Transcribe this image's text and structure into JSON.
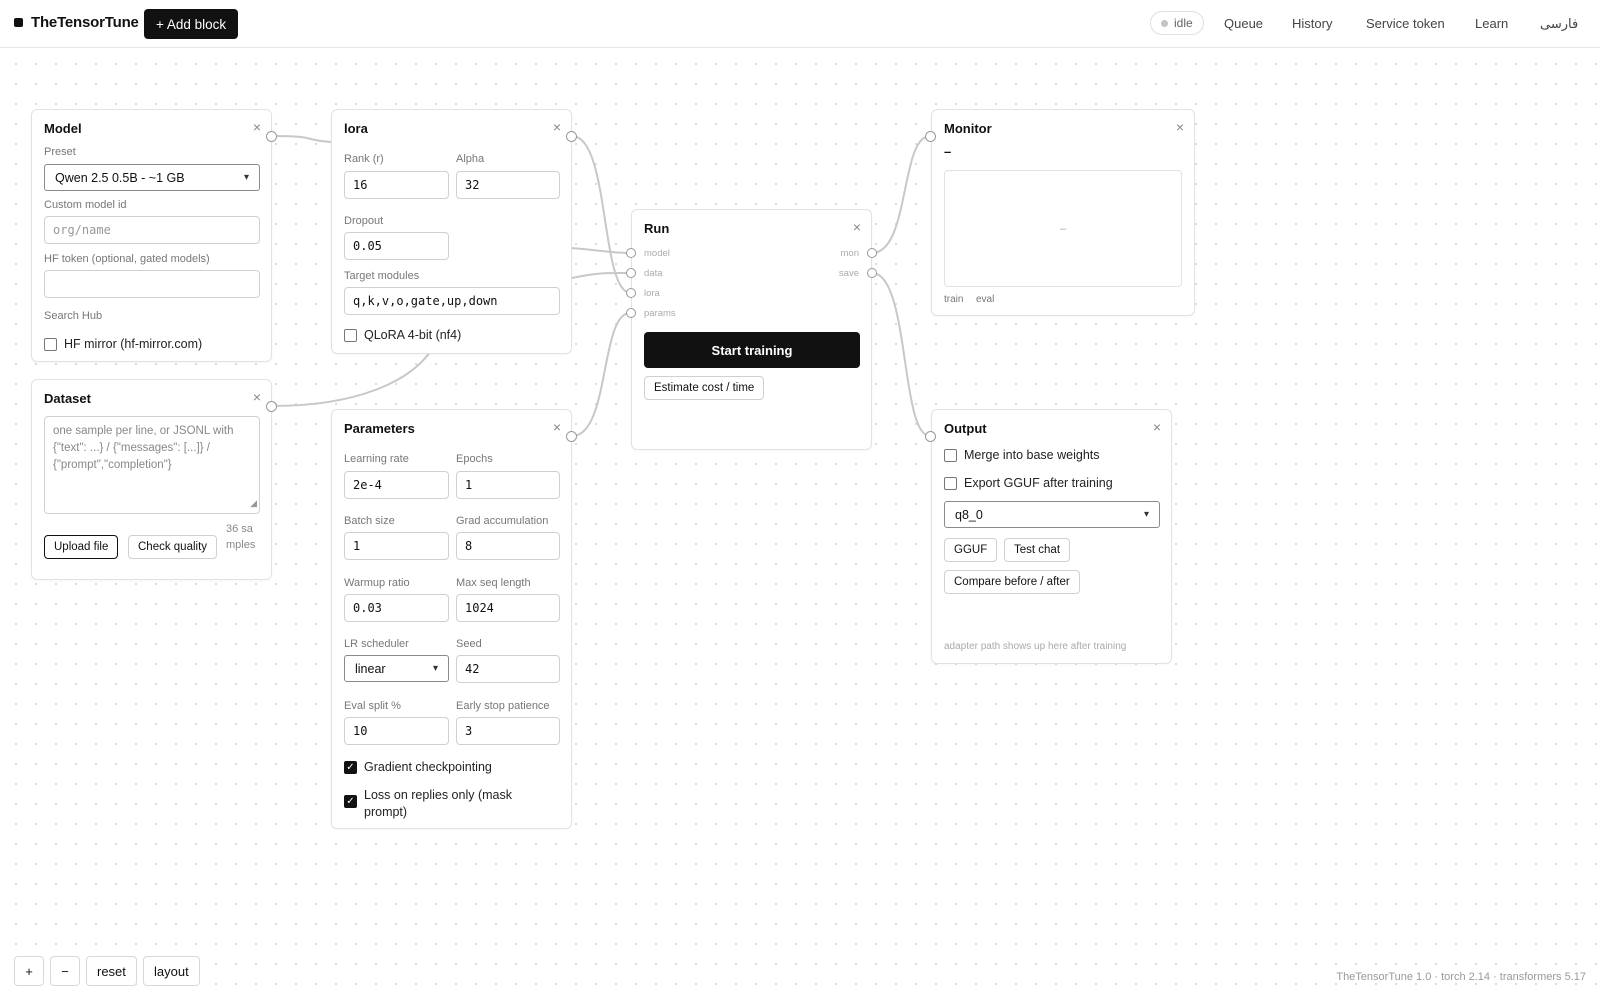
{
  "app": {
    "name": "TheTensorTune",
    "add_block": "+ Add block",
    "status": "idle",
    "nav": [
      "Queue",
      "History",
      "Service token",
      "Learn",
      "فارسی"
    ]
  },
  "model": {
    "title": "Model",
    "preset_label": "Preset",
    "preset_value": "Qwen 2.5 0.5B - ~1 GB",
    "custom_label": "Custom model id",
    "custom_placeholder": "org/name",
    "token_label": "HF token (optional, gated models)",
    "token_value": "",
    "search_hub": "Search Hub",
    "mirror_label": "HF mirror (hf-mirror.com)",
    "mirror_checked": false
  },
  "lora": {
    "title": "lora",
    "rank_label": "Rank (r)",
    "rank_value": "16",
    "alpha_label": "Alpha",
    "alpha_value": "32",
    "dropout_label": "Dropout",
    "dropout_value": "0.05",
    "target_label": "Target modules",
    "target_value": "q,k,v,o,gate,up,down",
    "qlora_label": "QLoRA 4-bit (nf4)",
    "qlora_checked": false
  },
  "dataset": {
    "title": "Dataset",
    "placeholder": "one sample per line, or JSONL with {\"text\": ...} / {\"messages\": [...]} / {\"prompt\",\"completion\"}",
    "upload": "Upload file",
    "check": "Check quality",
    "count": "36 samples"
  },
  "parameters": {
    "title": "Parameters",
    "lr_label": "Learning rate",
    "lr_value": "2e-4",
    "epochs_label": "Epochs",
    "epochs_value": "1",
    "batch_label": "Batch size",
    "batch_value": "1",
    "grad_label": "Grad accumulation",
    "grad_value": "8",
    "warmup_label": "Warmup ratio",
    "warmup_value": "0.03",
    "maxseq_label": "Max seq length",
    "maxseq_value": "1024",
    "sched_label": "LR scheduler",
    "sched_value": "linear",
    "seed_label": "Seed",
    "seed_value": "42",
    "eval_label": "Eval split %",
    "eval_value": "10",
    "early_label": "Early stop patience",
    "early_value": "3",
    "gradckpt_label": "Gradient checkpointing",
    "gradckpt_checked": true,
    "mask_label": "Loss on replies only (mask prompt)",
    "mask_checked": true
  },
  "run": {
    "title": "Run",
    "in_ports": [
      "model",
      "data",
      "lora",
      "params"
    ],
    "out_ports": [
      "mon",
      "save"
    ],
    "start": "Start training",
    "estimate": "Estimate cost / time"
  },
  "monitor": {
    "title": "Monitor",
    "value": "–",
    "chart_placeholder": "–",
    "legend": [
      "train",
      "eval"
    ]
  },
  "output": {
    "title": "Output",
    "merge_label": "Merge into base weights",
    "merge_checked": false,
    "gguf_export_label": "Export GGUF after training",
    "gguf_export_checked": false,
    "quant_value": "q8_0",
    "btn_gguf": "GGUF",
    "btn_chat": "Test chat",
    "btn_compare": "Compare before / after",
    "note": "adapter path shows up here after training"
  },
  "controls": {
    "zoom_in": "+",
    "zoom_out": "−",
    "reset": "reset",
    "layout": "layout"
  },
  "footer": "TheTensorTune 1.0 · torch 2.14 · transformers 5.17",
  "icons": {
    "close": "close-icon",
    "chevron": "chevron-down-icon",
    "check": "checkmark-icon",
    "dot": "status-dot-icon"
  }
}
